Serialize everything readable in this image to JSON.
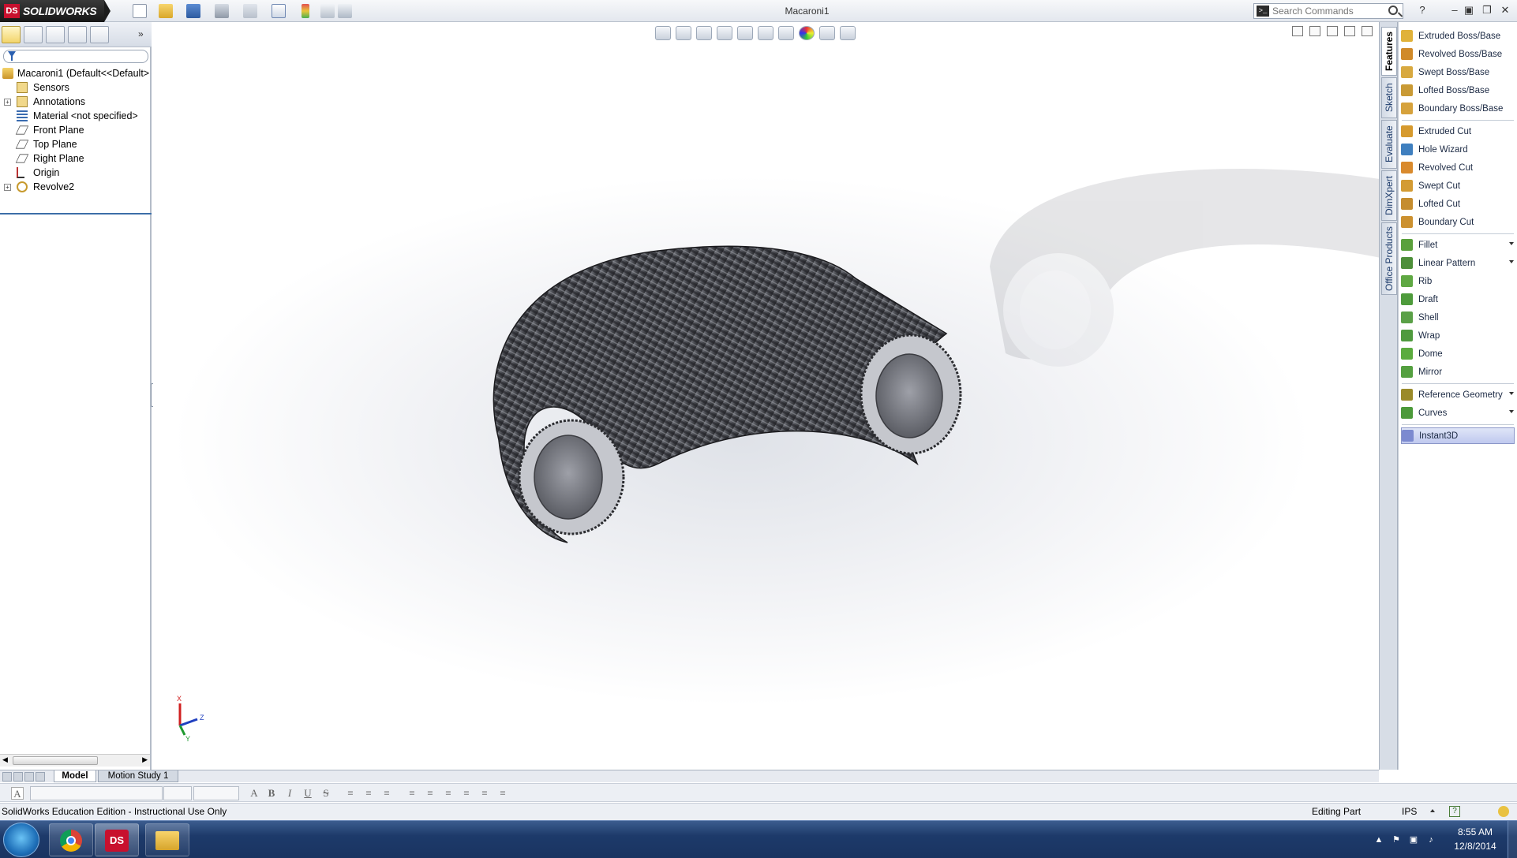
{
  "titlebar": {
    "brand": "SOLIDWORKS",
    "brand_mark": "DS",
    "document_title": "Macaroni1",
    "search_placeholder": "Search Commands",
    "help_label": "?"
  },
  "feature_tree": {
    "root": "Macaroni1  (Default<<Default>",
    "items": [
      {
        "label": "Sensors",
        "expandable": false
      },
      {
        "label": "Annotations",
        "expandable": true
      },
      {
        "label": "Material <not specified>",
        "expandable": false
      },
      {
        "label": "Front Plane",
        "expandable": false
      },
      {
        "label": "Top Plane",
        "expandable": false
      },
      {
        "label": "Right Plane",
        "expandable": false
      },
      {
        "label": "Origin",
        "expandable": false
      },
      {
        "label": "Revolve2",
        "expandable": true
      }
    ],
    "expander_symbol": "+"
  },
  "triad": {
    "x": "X",
    "y": "Y",
    "z": "Z"
  },
  "vertical_tabs": [
    "Features",
    "Sketch",
    "Evaluate",
    "DimXpert",
    "Office Products"
  ],
  "commands": {
    "groups": [
      [
        {
          "label": "Extruded Boss/Base",
          "color": "#e0b23a"
        },
        {
          "label": "Revolved Boss/Base",
          "color": "#d08a2a"
        },
        {
          "label": "Swept Boss/Base",
          "color": "#d8a940"
        },
        {
          "label": "Lofted Boss/Base",
          "color": "#c99a35"
        },
        {
          "label": "Boundary Boss/Base",
          "color": "#d6a23c"
        }
      ],
      [
        {
          "label": "Extruded Cut",
          "color": "#d69a2e"
        },
        {
          "label": "Hole Wizard",
          "color": "#3f7fbf"
        },
        {
          "label": "Revolved Cut",
          "color": "#d98a2d"
        },
        {
          "label": "Swept Cut",
          "color": "#d39b33"
        },
        {
          "label": "Lofted Cut",
          "color": "#c58d2f"
        },
        {
          "label": "Boundary Cut",
          "color": "#cc9130"
        }
      ],
      [
        {
          "label": "Fillet",
          "color": "#5aa03c",
          "dropdown": true
        },
        {
          "label": "Linear Pattern",
          "color": "#4d8f3a",
          "dropdown": true
        },
        {
          "label": "Rib",
          "color": "#5fa843"
        },
        {
          "label": "Draft",
          "color": "#4e9b3c"
        },
        {
          "label": "Shell",
          "color": "#5aa047"
        },
        {
          "label": "Wrap",
          "color": "#4f9a3e"
        },
        {
          "label": "Dome",
          "color": "#5bab3f"
        },
        {
          "label": "Mirror",
          "color": "#54a040"
        }
      ],
      [
        {
          "label": "Reference Geometry",
          "color": "#9a8a2a",
          "dropdown": true
        },
        {
          "label": "Curves",
          "color": "#4c9a3a",
          "dropdown": true
        }
      ],
      [
        {
          "label": "Instant3D",
          "color": "#7c8ad0",
          "selected": true
        }
      ]
    ]
  },
  "bottom_tabs": {
    "model": "Model",
    "motion": "Motion Study 1"
  },
  "format_bar": {
    "bold": "B",
    "italic": "I",
    "underline": "U",
    "strike": "S",
    "font_glyph": "A"
  },
  "statusbar": {
    "left": "SolidWorks Education Edition - Instructional Use Only",
    "mode": "Editing Part",
    "units": "IPS",
    "help": "?"
  },
  "taskbar": {
    "time": "8:55 AM",
    "date": "12/8/2014"
  },
  "colors": {
    "accent": "#3c6ea8",
    "brand_red": "#c8102e",
    "taskbar": "#1d3a6a"
  }
}
